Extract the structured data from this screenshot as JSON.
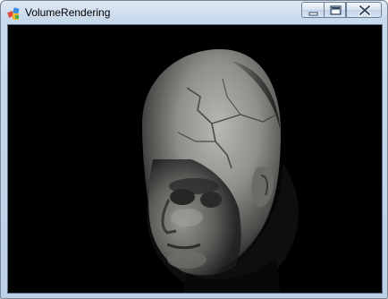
{
  "window": {
    "title": "VolumeRendering",
    "background_title_fragments": [
      "",
      ""
    ]
  },
  "controls": {
    "minimize_icon": "minimize-icon",
    "maximize_icon": "maximize-icon",
    "close_icon": "close-icon"
  },
  "viewport": {
    "content": "volume-rendering-head",
    "background_color": "#000000"
  }
}
